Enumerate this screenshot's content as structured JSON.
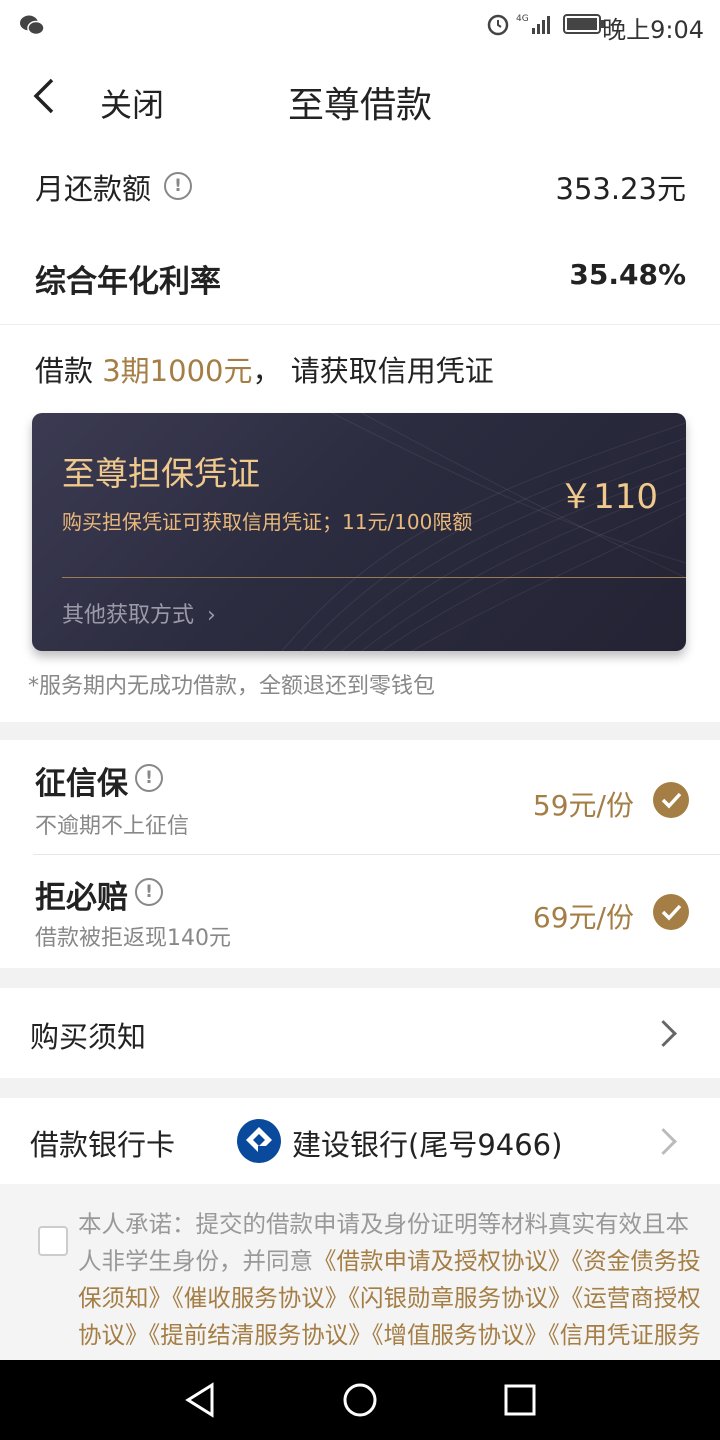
{
  "status": {
    "time": "晚上9:04"
  },
  "nav": {
    "close_label": "关闭",
    "title": "至尊借款"
  },
  "monthly": {
    "label": "月还款额",
    "value": "353.23元"
  },
  "rate": {
    "label": "综合年化利率",
    "value": "35.48%"
  },
  "loan": {
    "prefix": "借款 ",
    "highlight": "3期1000元",
    "suffix": "， 请获取信用凭证"
  },
  "card": {
    "title": "至尊担保凭证",
    "desc": "购买担保凭证可获取信用凭证；11元/100限额",
    "price": "￥110",
    "other_label": "其他获取方式"
  },
  "refund_note": "*服务期内无成功借款，全额退还到零钱包",
  "addons": [
    {
      "title": "征信保",
      "sub": "不逾期不上征信",
      "price": "59元/份"
    },
    {
      "title": "拒必赔",
      "sub": "借款被拒返现140元",
      "price": "69元/份"
    }
  ],
  "notice": {
    "label": "购买须知"
  },
  "bank": {
    "label": "借款银行卡",
    "name": "建设银行(尾号9466)"
  },
  "agreement": {
    "plain": "本人承诺：提交的借款申请及身份证明等材料真实有效且本人非学生身份，并同意",
    "links": "《借款申请及授权协议》《资金债务投保须知》《催收服务协议》《闪银勋章服务协议》《运营商授权协议》《提前结清服务协议》《增值服务协议》《信用凭证服务协议》"
  },
  "colors": {
    "gold": "#a47e45",
    "card_bg": "#2c2c40",
    "card_title": "#f0c98c"
  }
}
